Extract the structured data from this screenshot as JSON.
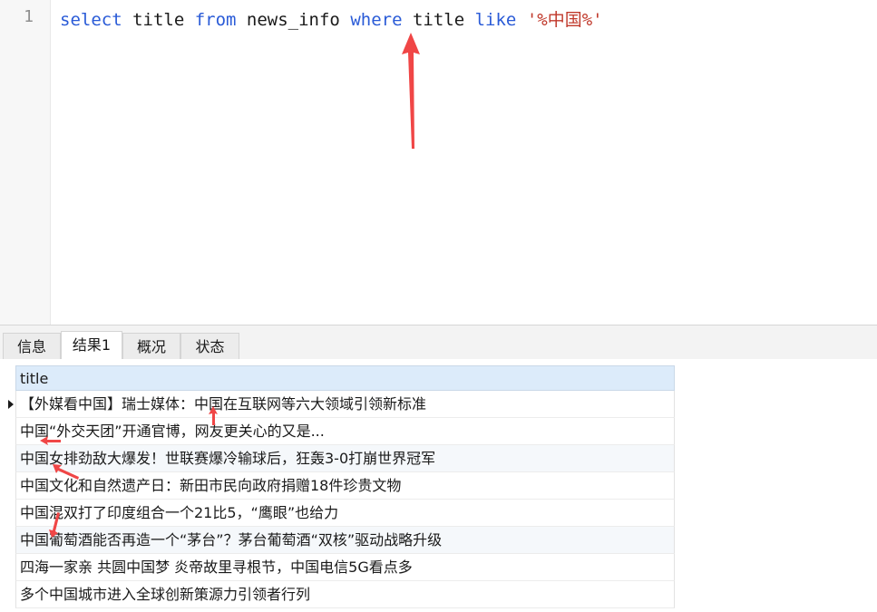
{
  "editor": {
    "line_number": "1",
    "tokens": {
      "select": "select",
      "col": " title ",
      "from": "from",
      "table": " news_info ",
      "where": "where",
      "col2": " title ",
      "like": "like",
      "space": " ",
      "pattern": "'%中国%'"
    }
  },
  "tabs": [
    {
      "label": "信息"
    },
    {
      "label": "结果1"
    },
    {
      "label": "概况"
    },
    {
      "label": "状态"
    }
  ],
  "grid": {
    "column": "title",
    "rows": [
      "【外媒看中国】瑞士媒体：中国在互联网等六大领域引领新标准",
      "中国“外交天团”开通官博，网友更关心的又是...",
      "中国女排劲敌大爆发！世联赛爆冷输球后，狂轰3-0打崩世界冠军",
      "中国文化和自然遗产日：新田市民向政府捐赠18件珍贵文物",
      "中国混双打了印度组合一个21比5，“鹰眼”也给力",
      "中国葡萄酒能否再造一个“茅台”？茅台葡萄酒“双核”驱动战略升级",
      "四海一家亲 共圆中国梦 炎帝故里寻根节，中国电信5G看点多",
      "多个中国城市进入全球创新策源力引领者行列"
    ]
  },
  "colors": {
    "keyword": "#2a5bd7",
    "string": "#c0392b",
    "annotation_arrow": "#f04646",
    "header_bg": "#dcebfa"
  }
}
